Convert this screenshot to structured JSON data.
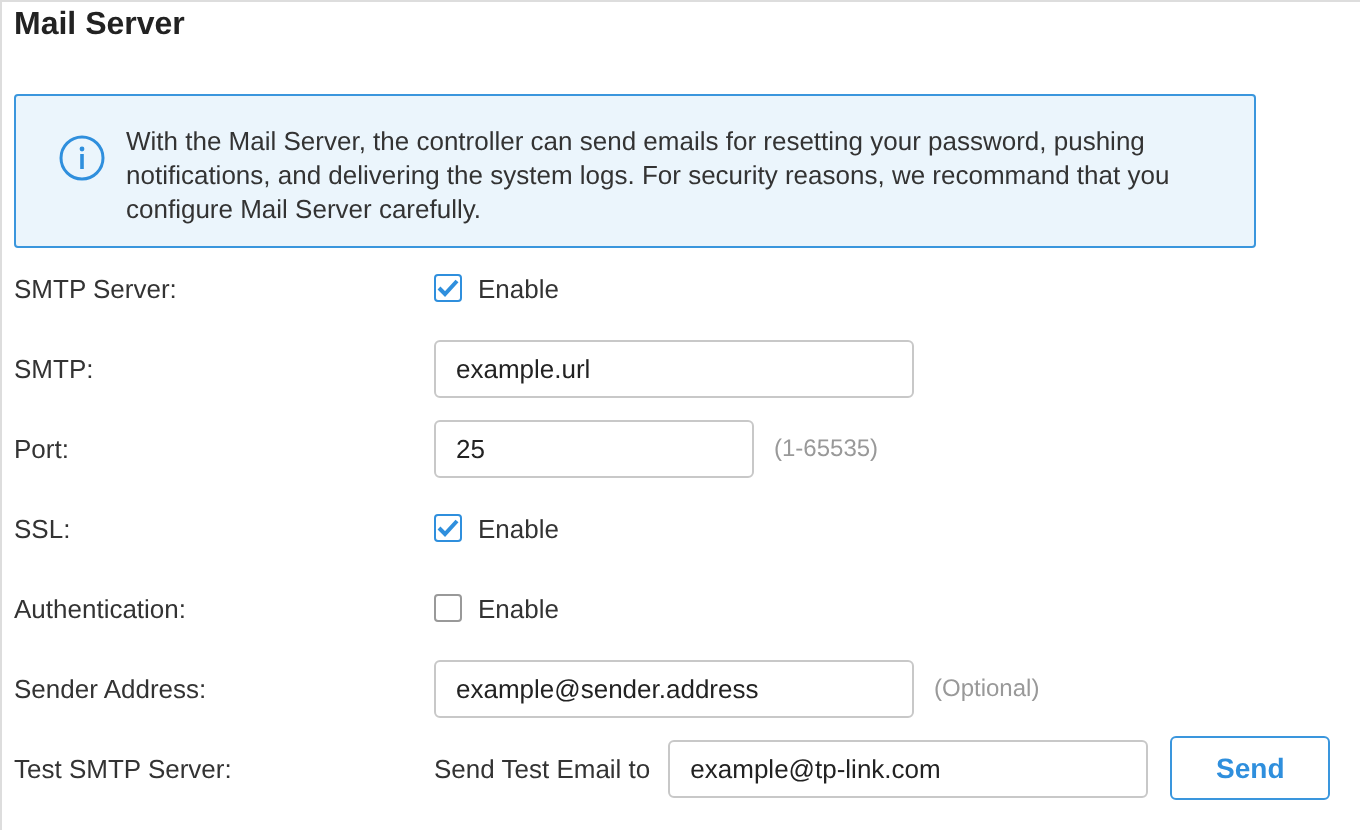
{
  "title": "Mail Server",
  "info": "With the Mail Server, the controller can send emails for resetting your password, pushing notifications, and delivering the system logs. For security reasons, we recommand that you configure Mail Server carefully.",
  "rows": [
    {
      "label": "SMTP Server:",
      "kind": "checkbox",
      "checked": true,
      "text": "Enable"
    },
    {
      "label": "SMTP:",
      "kind": "input",
      "value": "example.url",
      "short": false
    },
    {
      "label": "Port:",
      "kind": "input",
      "value": "25",
      "short": true,
      "hint": "(1-65535)"
    },
    {
      "label": "SSL:",
      "kind": "checkbox",
      "checked": true,
      "text": "Enable"
    },
    {
      "label": "Authentication:",
      "kind": "checkbox",
      "checked": false,
      "text": "Enable"
    },
    {
      "label": "Sender Address:",
      "kind": "input",
      "value": "example@sender.address",
      "short": false,
      "hint": "(Optional)"
    },
    {
      "label": "Test SMTP Server:",
      "kind": "test",
      "text": "Send Test Email to",
      "value": "example@tp-link.com",
      "button": "Send"
    }
  ]
}
